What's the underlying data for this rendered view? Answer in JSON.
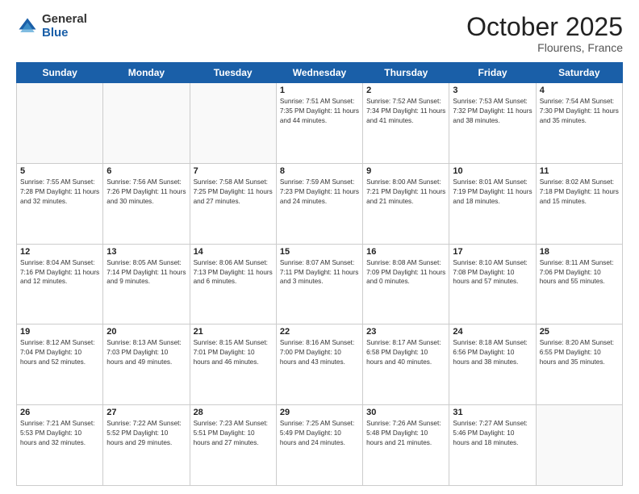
{
  "header": {
    "logo_general": "General",
    "logo_blue": "Blue",
    "month": "October 2025",
    "location": "Flourens, France"
  },
  "days_of_week": [
    "Sunday",
    "Monday",
    "Tuesday",
    "Wednesday",
    "Thursday",
    "Friday",
    "Saturday"
  ],
  "weeks": [
    [
      {
        "day": "",
        "info": ""
      },
      {
        "day": "",
        "info": ""
      },
      {
        "day": "",
        "info": ""
      },
      {
        "day": "1",
        "info": "Sunrise: 7:51 AM\nSunset: 7:35 PM\nDaylight: 11 hours\nand 44 minutes."
      },
      {
        "day": "2",
        "info": "Sunrise: 7:52 AM\nSunset: 7:34 PM\nDaylight: 11 hours\nand 41 minutes."
      },
      {
        "day": "3",
        "info": "Sunrise: 7:53 AM\nSunset: 7:32 PM\nDaylight: 11 hours\nand 38 minutes."
      },
      {
        "day": "4",
        "info": "Sunrise: 7:54 AM\nSunset: 7:30 PM\nDaylight: 11 hours\nand 35 minutes."
      }
    ],
    [
      {
        "day": "5",
        "info": "Sunrise: 7:55 AM\nSunset: 7:28 PM\nDaylight: 11 hours\nand 32 minutes."
      },
      {
        "day": "6",
        "info": "Sunrise: 7:56 AM\nSunset: 7:26 PM\nDaylight: 11 hours\nand 30 minutes."
      },
      {
        "day": "7",
        "info": "Sunrise: 7:58 AM\nSunset: 7:25 PM\nDaylight: 11 hours\nand 27 minutes."
      },
      {
        "day": "8",
        "info": "Sunrise: 7:59 AM\nSunset: 7:23 PM\nDaylight: 11 hours\nand 24 minutes."
      },
      {
        "day": "9",
        "info": "Sunrise: 8:00 AM\nSunset: 7:21 PM\nDaylight: 11 hours\nand 21 minutes."
      },
      {
        "day": "10",
        "info": "Sunrise: 8:01 AM\nSunset: 7:19 PM\nDaylight: 11 hours\nand 18 minutes."
      },
      {
        "day": "11",
        "info": "Sunrise: 8:02 AM\nSunset: 7:18 PM\nDaylight: 11 hours\nand 15 minutes."
      }
    ],
    [
      {
        "day": "12",
        "info": "Sunrise: 8:04 AM\nSunset: 7:16 PM\nDaylight: 11 hours\nand 12 minutes."
      },
      {
        "day": "13",
        "info": "Sunrise: 8:05 AM\nSunset: 7:14 PM\nDaylight: 11 hours\nand 9 minutes."
      },
      {
        "day": "14",
        "info": "Sunrise: 8:06 AM\nSunset: 7:13 PM\nDaylight: 11 hours\nand 6 minutes."
      },
      {
        "day": "15",
        "info": "Sunrise: 8:07 AM\nSunset: 7:11 PM\nDaylight: 11 hours\nand 3 minutes."
      },
      {
        "day": "16",
        "info": "Sunrise: 8:08 AM\nSunset: 7:09 PM\nDaylight: 11 hours\nand 0 minutes."
      },
      {
        "day": "17",
        "info": "Sunrise: 8:10 AM\nSunset: 7:08 PM\nDaylight: 10 hours\nand 57 minutes."
      },
      {
        "day": "18",
        "info": "Sunrise: 8:11 AM\nSunset: 7:06 PM\nDaylight: 10 hours\nand 55 minutes."
      }
    ],
    [
      {
        "day": "19",
        "info": "Sunrise: 8:12 AM\nSunset: 7:04 PM\nDaylight: 10 hours\nand 52 minutes."
      },
      {
        "day": "20",
        "info": "Sunrise: 8:13 AM\nSunset: 7:03 PM\nDaylight: 10 hours\nand 49 minutes."
      },
      {
        "day": "21",
        "info": "Sunrise: 8:15 AM\nSunset: 7:01 PM\nDaylight: 10 hours\nand 46 minutes."
      },
      {
        "day": "22",
        "info": "Sunrise: 8:16 AM\nSunset: 7:00 PM\nDaylight: 10 hours\nand 43 minutes."
      },
      {
        "day": "23",
        "info": "Sunrise: 8:17 AM\nSunset: 6:58 PM\nDaylight: 10 hours\nand 40 minutes."
      },
      {
        "day": "24",
        "info": "Sunrise: 8:18 AM\nSunset: 6:56 PM\nDaylight: 10 hours\nand 38 minutes."
      },
      {
        "day": "25",
        "info": "Sunrise: 8:20 AM\nSunset: 6:55 PM\nDaylight: 10 hours\nand 35 minutes."
      }
    ],
    [
      {
        "day": "26",
        "info": "Sunrise: 7:21 AM\nSunset: 5:53 PM\nDaylight: 10 hours\nand 32 minutes."
      },
      {
        "day": "27",
        "info": "Sunrise: 7:22 AM\nSunset: 5:52 PM\nDaylight: 10 hours\nand 29 minutes."
      },
      {
        "day": "28",
        "info": "Sunrise: 7:23 AM\nSunset: 5:51 PM\nDaylight: 10 hours\nand 27 minutes."
      },
      {
        "day": "29",
        "info": "Sunrise: 7:25 AM\nSunset: 5:49 PM\nDaylight: 10 hours\nand 24 minutes."
      },
      {
        "day": "30",
        "info": "Sunrise: 7:26 AM\nSunset: 5:48 PM\nDaylight: 10 hours\nand 21 minutes."
      },
      {
        "day": "31",
        "info": "Sunrise: 7:27 AM\nSunset: 5:46 PM\nDaylight: 10 hours\nand 18 minutes."
      },
      {
        "day": "",
        "info": ""
      }
    ]
  ]
}
